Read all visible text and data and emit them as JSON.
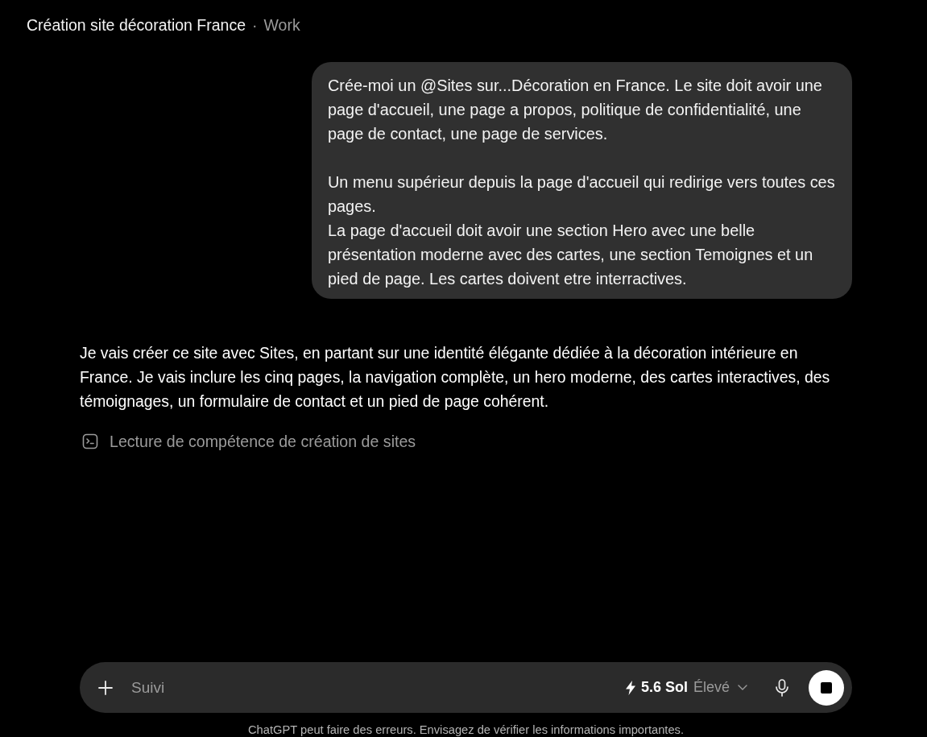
{
  "header": {
    "title": "Création site décoration France",
    "separator": "·",
    "workspace": "Work"
  },
  "conversation": {
    "user_message": {
      "paragraphs": [
        "Crée-moi un @Sites sur...Décoration en France. Le site doit avoir une page d'accueil, une page a propos, politique de confidentialité, une page de contact, une page de services.",
        "Un menu supérieur depuis la page d'accueil qui redirige vers toutes ces pages.\nLa page d'accueil doit avoir une section Hero avec une belle présentation moderne avec des cartes, une section Temoignes et un pied de page. Les cartes doivent etre interractives."
      ]
    },
    "assistant_message": {
      "text": "Je vais créer ce site avec Sites, en partant sur une identité élégante dédiée à la décoration intérieure en France. Je vais inclure les cinq pages, la navigation complète, un hero moderne, des cartes interactives, des témoignages, un formulaire de contact et un pied de page cohérent.",
      "activity": {
        "label": "Lecture de compétence de création de sites"
      }
    }
  },
  "composer": {
    "placeholder": "Suivi",
    "model": {
      "name": "5.6 Sol",
      "effort": "Élevé"
    },
    "generating": true
  },
  "disclaimer": "ChatGPT peut faire des erreurs. Envisagez de vérifier les informations importantes."
}
